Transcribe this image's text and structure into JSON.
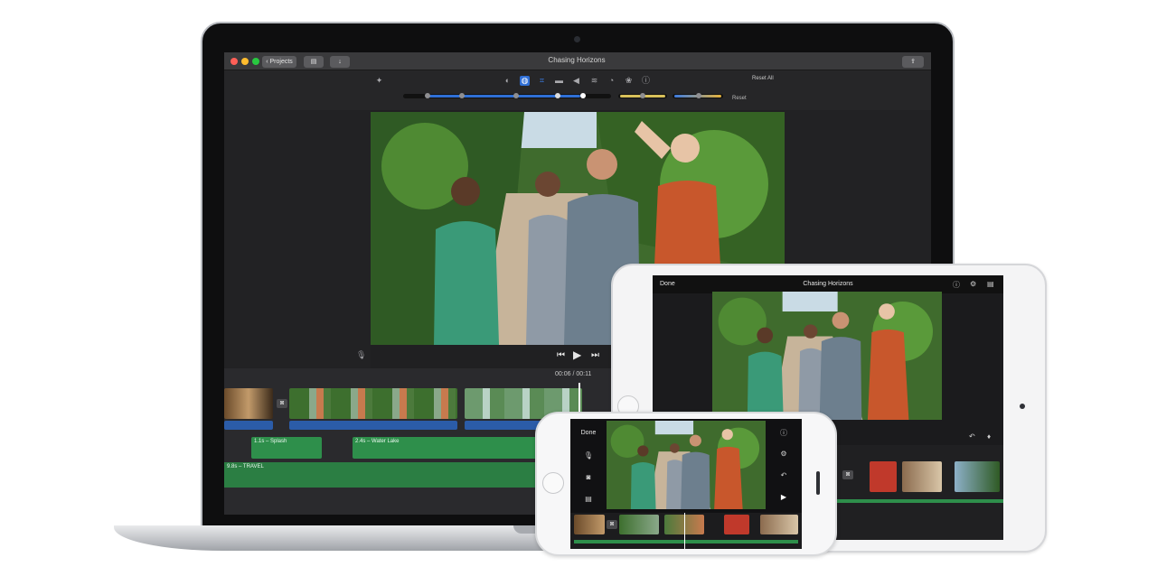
{
  "mac": {
    "window_title": "Chasing Horizons",
    "projects_label": "Projects",
    "reset_all_label": "Reset All",
    "reset_label": "Reset",
    "timecode": "06 / 00:11",
    "timecode_full": "00:06 / 00:11",
    "clips": {
      "splash": "1.1s – Splash",
      "water_lake": "2.4s – Water Lake",
      "travel": "9.8s – TRAVEL"
    },
    "icons": [
      "magic-wand-icon",
      "color-balance-icon",
      "color-correction-icon",
      "crop-icon",
      "stabilize-icon",
      "volume-icon",
      "noise-equalizer-icon",
      "speed-icon",
      "filter-icon",
      "info-icon",
      "share-icon",
      "import-icon",
      "library-icon",
      "microphone-icon",
      "previous-icon",
      "play-icon",
      "next-icon"
    ],
    "colors": {
      "accent_blue": "#2f6fd6",
      "audio_green": "#2e8f4b",
      "traffic_red": "#ff5f57",
      "traffic_yellow": "#febc2e",
      "traffic_green": "#28c840"
    }
  },
  "ipad": {
    "done_label": "Done",
    "title": "Chasing Horizons",
    "icons": [
      "help-icon",
      "settings-icon",
      "library-icon",
      "undo-icon",
      "music-note-icon"
    ]
  },
  "iphone": {
    "done_label": "Done",
    "icons": [
      "microphone-icon",
      "camera-icon",
      "library-icon",
      "help-icon",
      "settings-icon",
      "undo-icon",
      "play-icon"
    ]
  }
}
